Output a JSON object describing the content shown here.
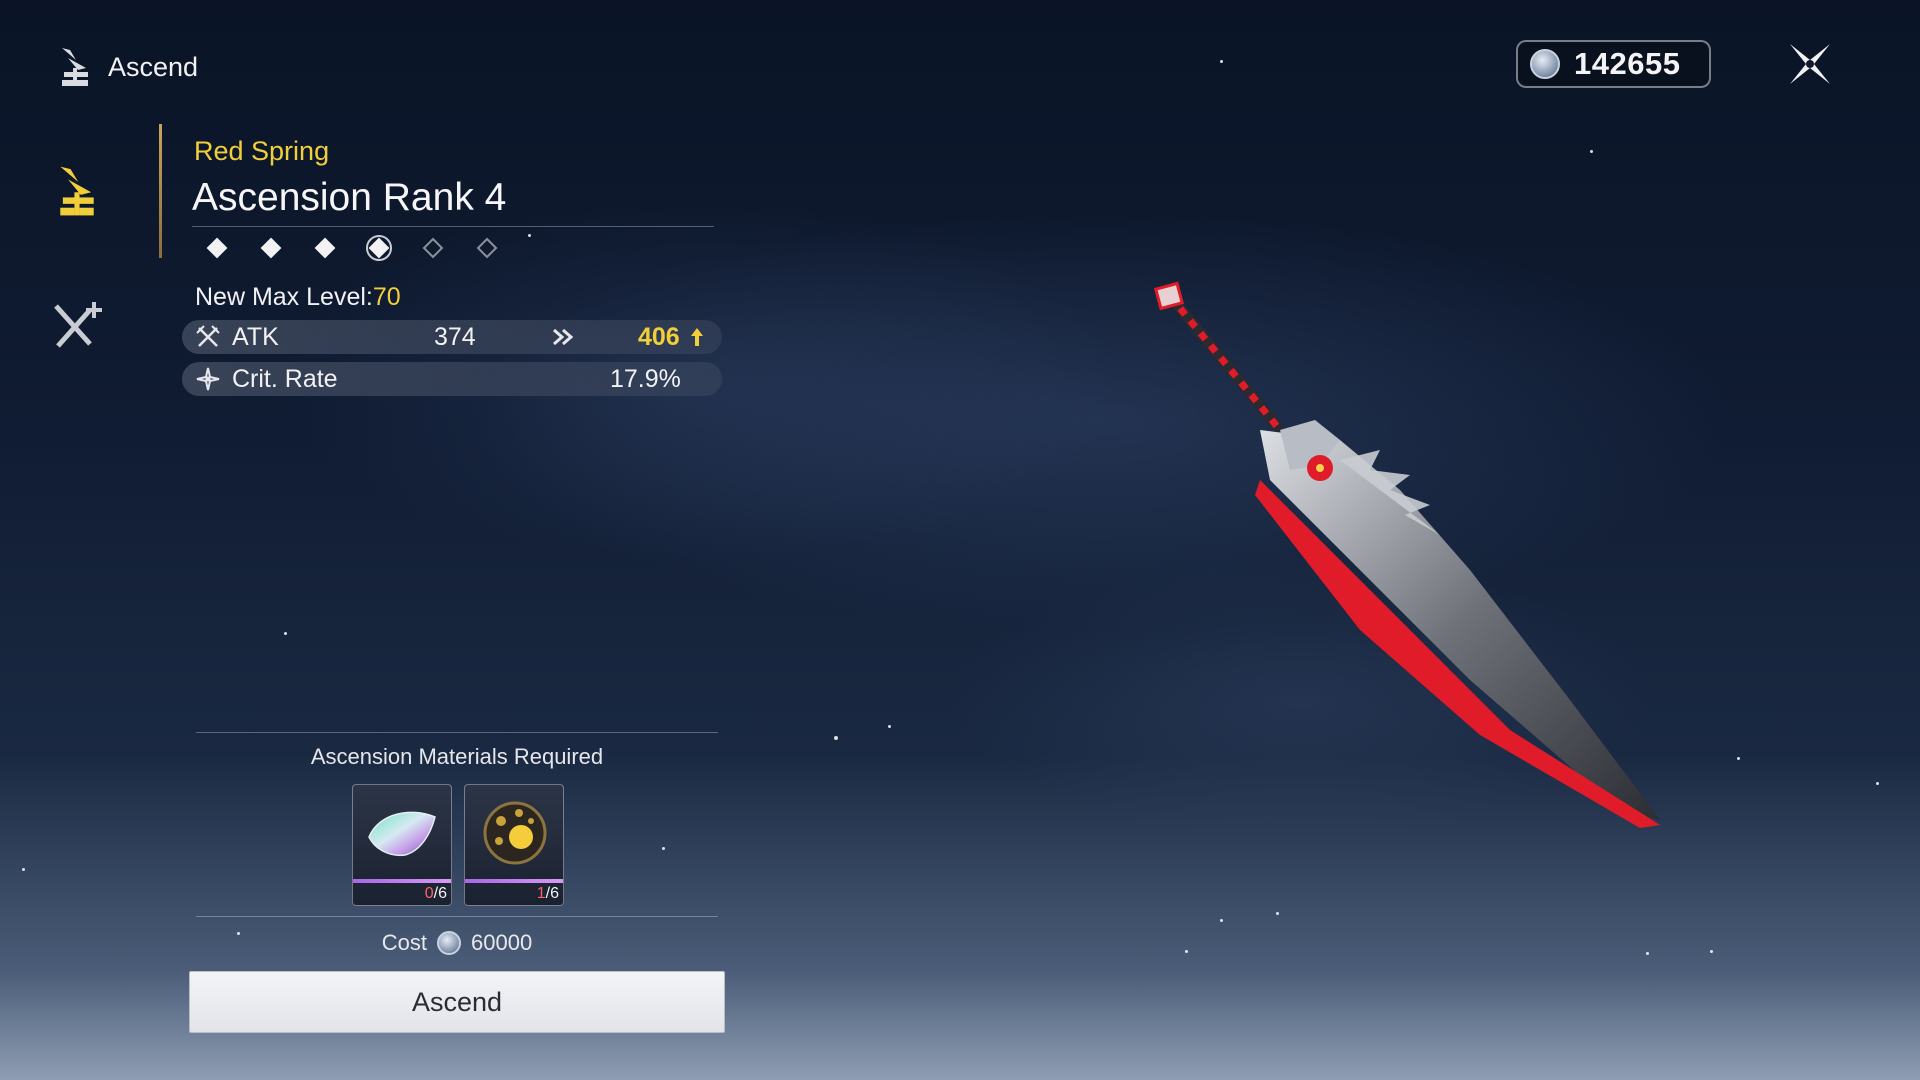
{
  "header": {
    "title": "Ascend",
    "title_icon": "ascend-icon"
  },
  "currency": {
    "icon": "shell-credit-coin-icon",
    "amount": "142655"
  },
  "close": {
    "icon": "close-icon"
  },
  "sidebar": {
    "items": [
      {
        "name": "ascend",
        "icon": "ascend-icon",
        "active": true
      },
      {
        "name": "level-up",
        "icon": "swords-plus-icon",
        "active": false
      }
    ]
  },
  "weapon": {
    "name": "Red Spring",
    "rank_title": "Ascension Rank 4",
    "rank_current": 4,
    "rank_max": 6
  },
  "max_level": {
    "label": "New Max Level:",
    "value": "70"
  },
  "stats": [
    {
      "name": "ATK",
      "icon": "atk-icon",
      "value": "374",
      "new_value": "406",
      "increase_icon": "arrow-up-icon"
    },
    {
      "name": "Crit. Rate",
      "icon": "crit-rate-icon",
      "value": "17.9%"
    }
  ],
  "materials": {
    "title": "Ascension Materials Required",
    "items": [
      {
        "name": "iridescent-shell-material",
        "have": "0",
        "need": "/6"
      },
      {
        "name": "golden-orb-material",
        "have": "1",
        "need": "/6"
      }
    ]
  },
  "cost": {
    "label": "Cost",
    "amount": "60000"
  },
  "action": {
    "label": "Ascend"
  },
  "colors": {
    "accent": "#f1cf3b",
    "text": "#f2f2f4",
    "deficit": "#ff6262",
    "weapon_red": "#e01b2a"
  }
}
